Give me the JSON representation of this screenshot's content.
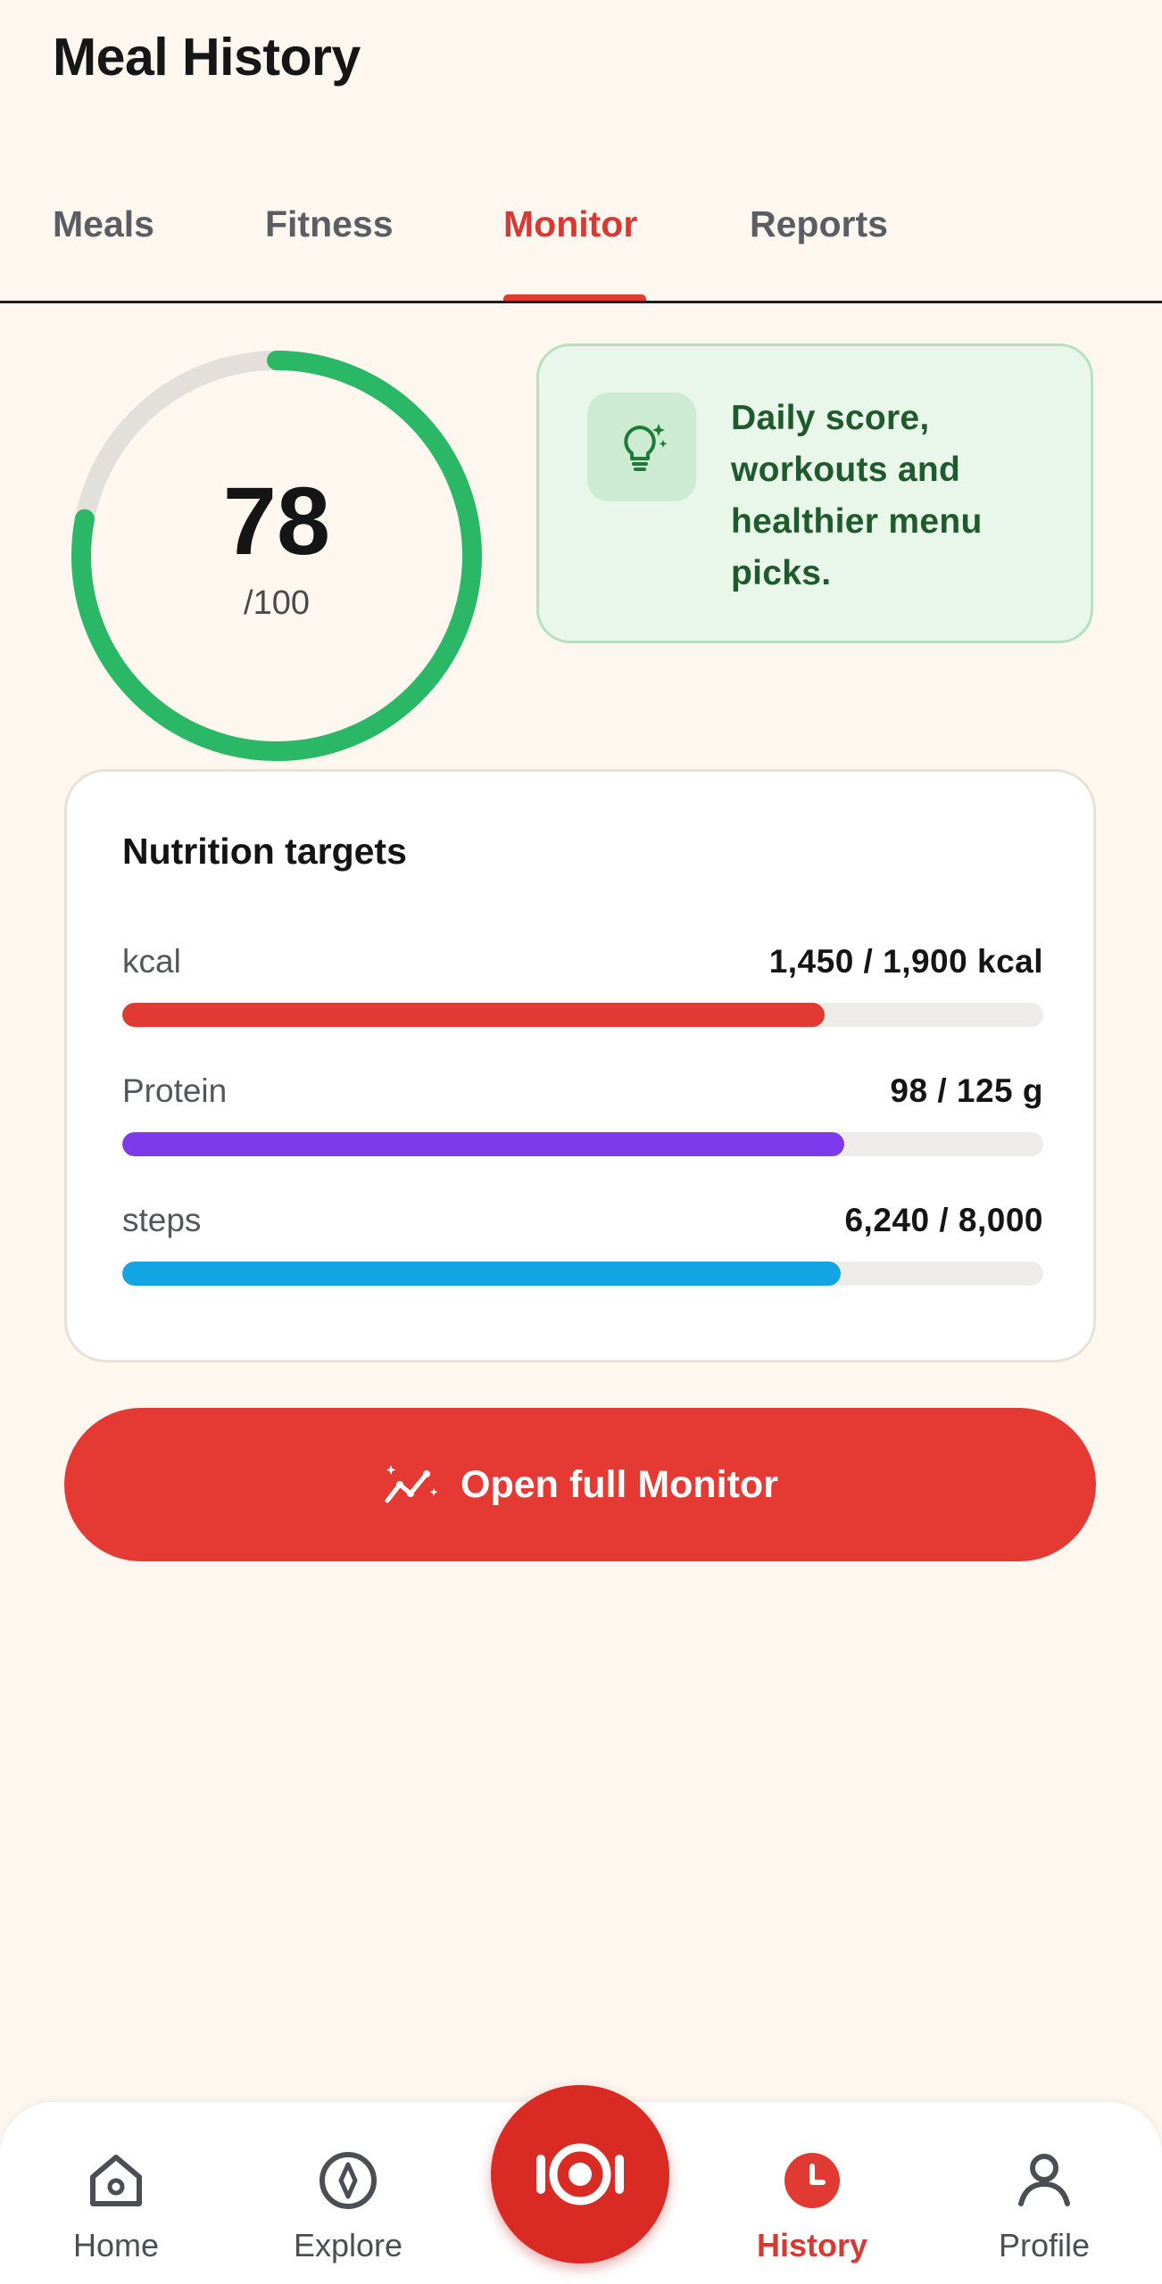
{
  "header": {
    "title": "Meal History"
  },
  "tabs": [
    {
      "label": "Meals",
      "active": false
    },
    {
      "label": "Fitness",
      "active": false
    },
    {
      "label": "Monitor",
      "active": true
    },
    {
      "label": "Reports",
      "active": false
    }
  ],
  "score": {
    "value": "78",
    "max_label": "/100",
    "fraction": 0.78,
    "color": "#2bb866",
    "track_color": "#e3e0db"
  },
  "tip": {
    "icon": "lightbulb-sparkle-icon",
    "text": "Daily score, workouts and healthier menu picks."
  },
  "nutrition": {
    "title": "Nutrition targets",
    "rows": [
      {
        "label": "kcal",
        "value": "1,450 / 1,900 kcal",
        "fraction": 0.763,
        "color": "#e03a33"
      },
      {
        "label": "Protein",
        "value": "98 / 125 g",
        "fraction": 0.784,
        "color": "#7c3aea"
      },
      {
        "label": "steps",
        "value": "6,240 / 8,000",
        "fraction": 0.78,
        "color": "#13a4e4"
      }
    ]
  },
  "action": {
    "label": "Open full Monitor",
    "icon": "chart-sparkle-icon"
  },
  "bottom_nav": {
    "items": [
      {
        "label": "Home",
        "icon": "home-icon",
        "active": false
      },
      {
        "label": "Explore",
        "icon": "compass-icon",
        "active": false
      },
      {
        "label": "History",
        "icon": "clock-icon",
        "active": true
      },
      {
        "label": "Profile",
        "icon": "person-icon",
        "active": false
      }
    ],
    "center_icon": "camera-plate-icon"
  },
  "colors": {
    "accent": "#e53a33",
    "background": "#fdf7f0",
    "success": "#2bb866"
  }
}
